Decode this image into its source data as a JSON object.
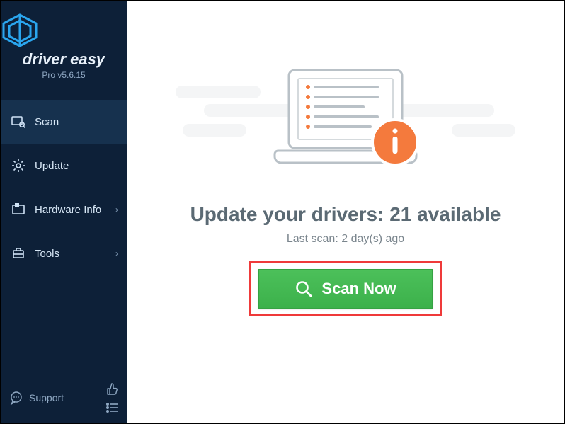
{
  "brand": {
    "name": "driver easy",
    "version": "Pro v5.6.15"
  },
  "sidebar": {
    "items": [
      {
        "label": "Scan"
      },
      {
        "label": "Update"
      },
      {
        "label": "Hardware Info"
      },
      {
        "label": "Tools"
      }
    ],
    "support_label": "Support"
  },
  "main": {
    "headline": "Update your drivers: 21 available",
    "last_scan": "Last scan: 2 day(s) ago",
    "scan_button": "Scan Now"
  },
  "colors": {
    "accent_green": "#3cb14b",
    "highlight_red": "#ef3a3a",
    "info_orange": "#f47a3d"
  }
}
